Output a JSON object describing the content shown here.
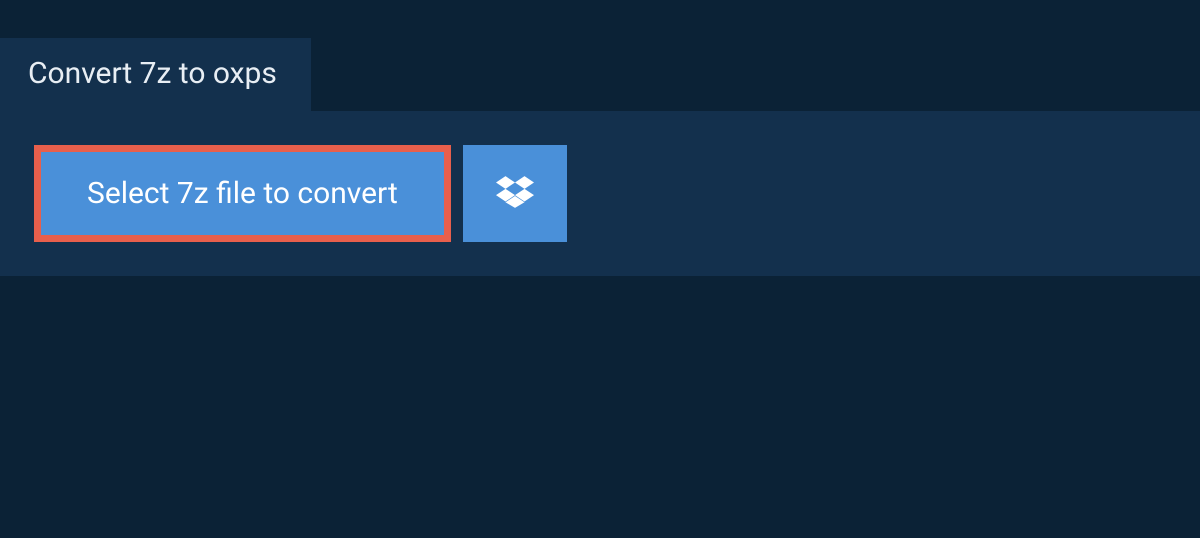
{
  "tab": {
    "label": "Convert 7z to oxps"
  },
  "actions": {
    "select_file_label": "Select 7z file to convert"
  }
}
